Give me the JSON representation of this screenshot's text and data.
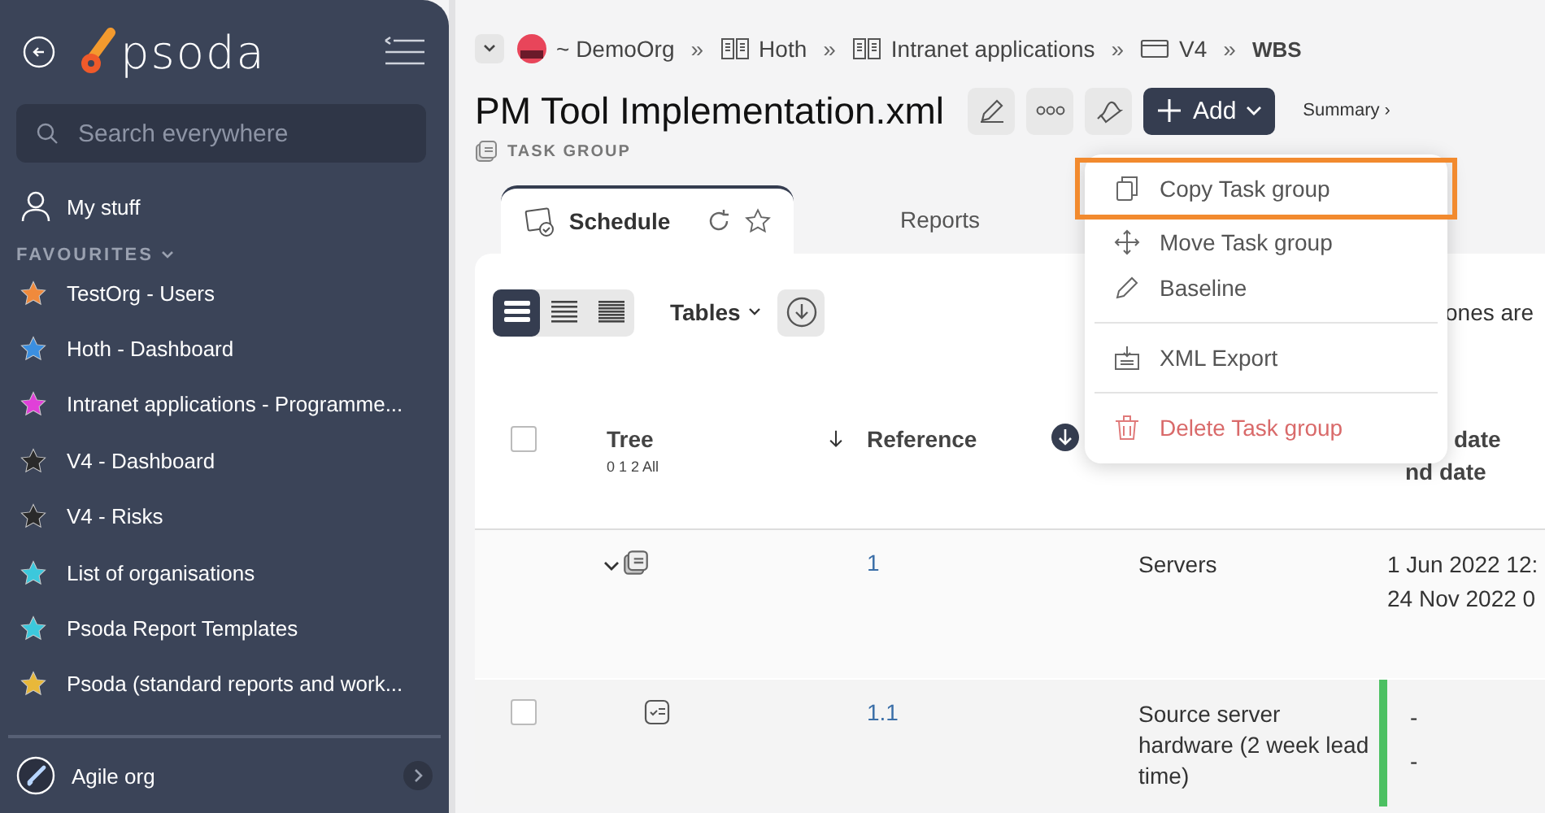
{
  "sidebar": {
    "logo": "psoda",
    "search": {
      "placeholder": "Search everywhere"
    },
    "my_stuff": "My stuff",
    "favourites_heading": "FAVOURITES",
    "favourites": [
      {
        "label": "TestOrg - Users",
        "color": "#f08a3c"
      },
      {
        "label": "Hoth - Dashboard",
        "color": "#3b8fe0"
      },
      {
        "label": "Intranet applications - Programme...",
        "color": "#e040d8"
      },
      {
        "label": "V4 - Dashboard",
        "color": "#2a2a2a"
      },
      {
        "label": "V4 - Risks",
        "color": "#2a2a2a"
      },
      {
        "label": "List of organisations",
        "color": "#3cc8dc"
      },
      {
        "label": "Psoda Report Templates",
        "color": "#3cc8dc"
      },
      {
        "label": "Psoda (standard reports and work...",
        "color": "#e8b83a"
      }
    ],
    "org": "Agile org"
  },
  "breadcrumbs": [
    {
      "label": "~ DemoOrg",
      "kind": "org"
    },
    {
      "label": "Hoth",
      "kind": "book"
    },
    {
      "label": "Intranet applications",
      "kind": "book"
    },
    {
      "label": "V4",
      "kind": "folder"
    },
    {
      "label": "WBS",
      "kind": "current"
    }
  ],
  "breadcrumb_separator": "»",
  "title": "PM Tool Implementation.xml",
  "subtitle": "TASK GROUP",
  "add_button": "Add",
  "summary_link": "Summary ›",
  "tabs": [
    {
      "label": "Schedule",
      "selected": true
    },
    {
      "label": "Reports",
      "selected": false
    }
  ],
  "view_modes": [
    {
      "selected": true
    },
    {
      "selected": false
    },
    {
      "selected": false
    }
  ],
  "tables_button": "Tables",
  "notice": "ones are",
  "table": {
    "select_all": {
      "checked": false
    },
    "columns": [
      {
        "label": "Tree",
        "sub": "0 1 2 All"
      },
      {
        "label": "Reference"
      },
      {
        "label": "date",
        "sub": "nd date"
      }
    ],
    "rows": [
      {
        "kind": "group",
        "expanded": true,
        "reference": "1",
        "name": "Servers",
        "dates": [
          "1 Jun 2022 12:",
          "24 Nov 2022 0"
        ]
      },
      {
        "kind": "task",
        "checked": false,
        "reference": "1.1",
        "name": "Source server hardware (2 week lead time)",
        "dates": [
          "-",
          "-"
        ],
        "color": "#4cc062"
      }
    ]
  },
  "menu": {
    "groups": [
      [
        {
          "label": "Copy Task group",
          "highlighted": true,
          "kind": "normal"
        },
        {
          "label": "Move Task group",
          "highlighted": false,
          "kind": "normal"
        },
        {
          "label": "Baseline",
          "highlighted": false,
          "kind": "normal"
        }
      ],
      [
        {
          "label": "XML Export",
          "highlighted": false,
          "kind": "normal"
        }
      ],
      [
        {
          "label": "Delete Task group",
          "highlighted": false,
          "kind": "danger"
        }
      ]
    ]
  }
}
